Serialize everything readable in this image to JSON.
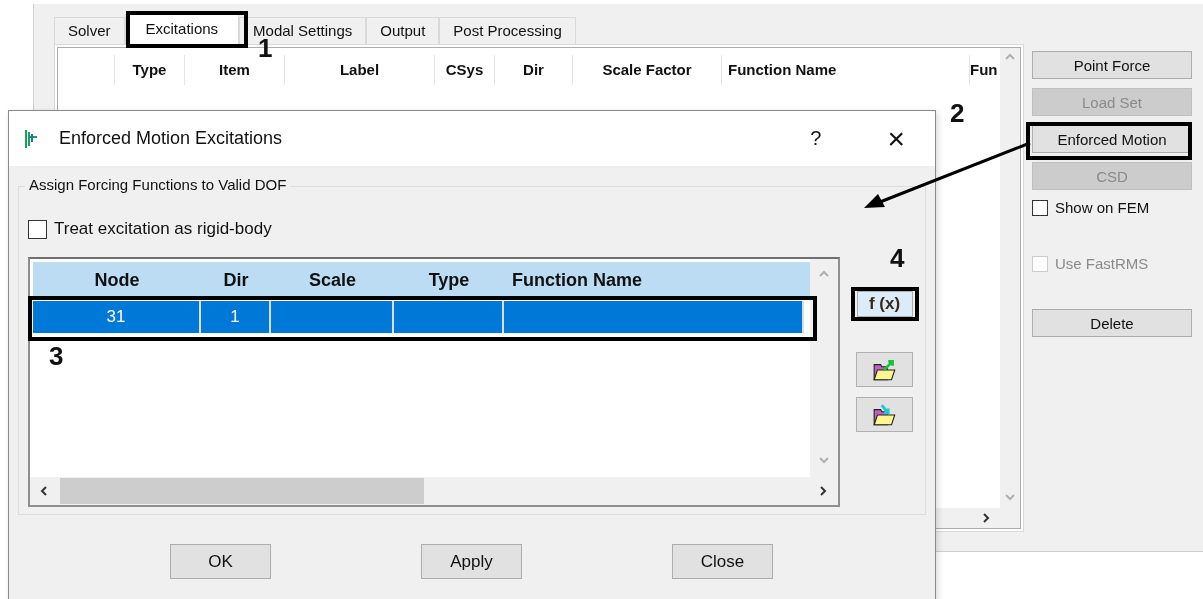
{
  "tabs": [
    {
      "label": "Solver",
      "selected": false
    },
    {
      "label": "Excitations",
      "selected": true
    },
    {
      "label": "Modal Settings",
      "selected": false
    },
    {
      "label": "Output",
      "selected": false
    },
    {
      "label": "Post Processing",
      "selected": false
    }
  ],
  "excitation_list": {
    "columns": [
      "Type",
      "Item",
      "Label",
      "CSys",
      "Dir",
      "Scale Factor",
      "Function Name",
      "Fun"
    ]
  },
  "side_controls": [
    {
      "kind": "button",
      "label": "Point Force",
      "disabled": false
    },
    {
      "kind": "button",
      "label": "Load Set",
      "disabled": true
    },
    {
      "kind": "button",
      "label": "Enforced Motion",
      "disabled": false
    },
    {
      "kind": "button",
      "label": "CSD",
      "disabled": true
    },
    {
      "kind": "checkbox",
      "label": "Show on FEM",
      "checked": false,
      "disabled": false
    },
    {
      "kind": "checkbox",
      "label": "Use FastRMS",
      "checked": false,
      "disabled": true
    },
    {
      "kind": "button",
      "label": "Delete",
      "disabled": false
    }
  ],
  "dialog": {
    "title": "Enforced Motion Excitations",
    "help": "?",
    "close": "×",
    "group_label": "Assign Forcing Functions to Valid DOF",
    "rigid_body": {
      "label": "Treat excitation as rigid-body",
      "checked": false
    },
    "grid": {
      "columns": [
        "Node",
        "Dir",
        "Scale",
        "Type",
        "Function Name"
      ],
      "rows": [
        {
          "selected": true,
          "cells": [
            {
              "text": "31"
            },
            {
              "text": "1"
            },
            {},
            {},
            {}
          ]
        }
      ]
    },
    "function_button": "f (x)",
    "buttons": [
      "OK",
      "Apply",
      "Close"
    ]
  },
  "callouts": [
    {
      "label": "1"
    },
    {
      "label": "2"
    },
    {
      "label": "3"
    },
    {
      "label": "4"
    }
  ]
}
